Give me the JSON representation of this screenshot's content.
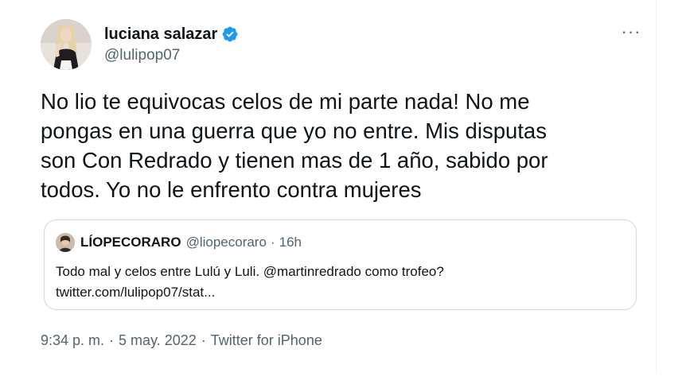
{
  "author": {
    "display_name": "luciana salazar",
    "handle": "@lulipop07",
    "verified": true,
    "avatar_icon": "profile-photo"
  },
  "more_menu": {
    "label": "···",
    "icon": "more-horizontal-icon"
  },
  "tweet": {
    "text": "No lio te equivocas celos de mi parte nada! No me\npongas en una guerra que yo no entre. Mis disputas\nson Con Redrado y tienen mas de 1 año, sabido por\ntodos. Yo no le enfrento contra mujeres"
  },
  "quote": {
    "display_name": "LÍOPECORARO",
    "handle": "@liopecoraro",
    "separator": "·",
    "time": "16h",
    "text_line1": "Todo mal y celos entre Lulú y Luli. @martinredrado como trofeo?",
    "text_line2": "twitter.com/lulipop07/stat..."
  },
  "meta": {
    "time": "9:34 p. m.",
    "separator": "·",
    "date": "5 may. 2022",
    "source": "Twitter for iPhone"
  },
  "colors": {
    "text_primary": "#0f1419",
    "text_secondary": "#536471",
    "verified_blue": "#1d9bf0",
    "border": "#cfd9de"
  }
}
